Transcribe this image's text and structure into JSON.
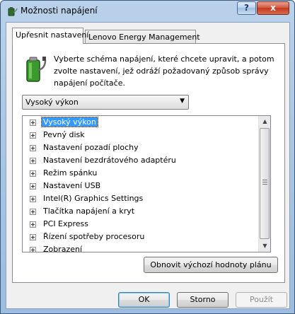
{
  "window": {
    "title": "Možnosti napájení",
    "help_label": "?",
    "close_label": "x"
  },
  "tabs": [
    {
      "label": "Upřesnit nastavení",
      "active": true
    },
    {
      "label": "Lenovo Energy Management",
      "active": false
    }
  ],
  "panel": {
    "description": "Vyberte schéma napájení, které chcete upravit, a potom zvolte nastavení, jež odráží požadovaný způsob správy napájení počítače.",
    "scheme_select": {
      "value": "Vysoký výkon",
      "arrow": "▼"
    },
    "tree_items": [
      {
        "label": "Vysoký výkon",
        "selected": true
      },
      {
        "label": "Pevný disk"
      },
      {
        "label": "Nastavení pozadí plochy"
      },
      {
        "label": "Nastavení bezdrátového adaptéru"
      },
      {
        "label": "Režim spánku"
      },
      {
        "label": "Nastavení USB"
      },
      {
        "label": "Intel(R) Graphics Settings"
      },
      {
        "label": "Tlačítka napájení a kryt"
      },
      {
        "label": "PCI Express"
      },
      {
        "label": "Řízení spotřeby procesoru"
      },
      {
        "label": "Zobrazení"
      }
    ],
    "scroll_up": "▲",
    "scroll_down": "▼",
    "restore_button": "Obnovit výchozí hodnoty plánu"
  },
  "buttons": {
    "ok": "OK",
    "cancel": "Storno",
    "apply": "Použít"
  },
  "colors": {
    "selection": "#3399ff",
    "titlebar": "#a6c3e2",
    "close": "#c3391a"
  }
}
